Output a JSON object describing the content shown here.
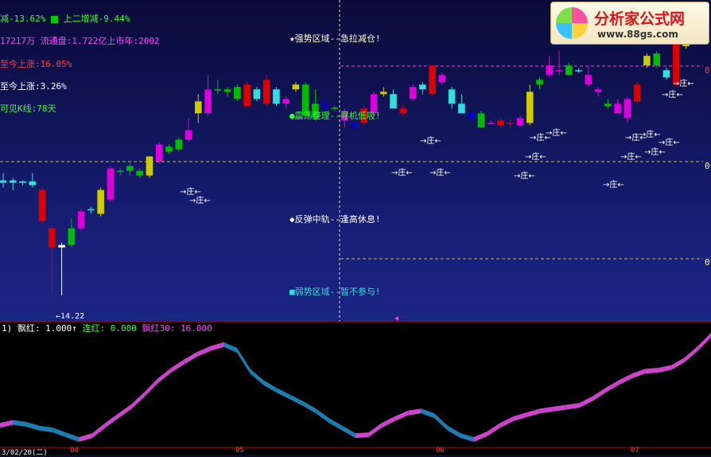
{
  "info_lines": [
    {
      "id": "line1a",
      "text": "减-13.62%",
      "color": "#33ff33"
    },
    {
      "id": "line1b",
      "text": "上二增减-9.44%",
      "color": "#33ff33",
      "marker": "green-square"
    },
    {
      "id": "line2",
      "text": "17217万  流通盘:1.722亿上市年:2002",
      "color": "#ff44ff"
    },
    {
      "id": "line3",
      "text": "至今上涨:16.05%",
      "color": "#ff4040"
    },
    {
      "id": "line4",
      "text": "至今上涨:3.26%",
      "color": "#ffffff"
    },
    {
      "id": "line5",
      "text": "可见K线:78天",
      "color": "#33ff33"
    }
  ],
  "zones": [
    {
      "id": "strong",
      "text": "★强势区域--急拉减仓!",
      "color": "#ffffcc"
    },
    {
      "id": "shake",
      "text": "●震荡整理--寻机低吸!",
      "color": "#33ff33"
    },
    {
      "id": "rebound",
      "text": "◆反弹中轨--逢高休息!",
      "color": "#ffffff"
    },
    {
      "id": "weak",
      "text": "■弱势区域--暂不参与!",
      "color": "#33dddd"
    }
  ],
  "right_axis_labels": [
    "0",
    "0",
    "0"
  ],
  "low_label": "←14.22",
  "indicator_header": {
    "index": "1)",
    "label1": "飘红: 1.000↑",
    "label2": "连红: 0.000",
    "label3": "飘红30: 16.000"
  },
  "bottom_axis": {
    "date": "3/02/20(二)",
    "months": [
      "04",
      "05",
      "06",
      "07"
    ]
  },
  "zhuang_mark": "→庄←",
  "logo": {
    "title": "分析家公式网",
    "url": "www.88gs.com"
  },
  "chart_data": {
    "type": "candlestick",
    "y_range": [
      13.8,
      20.2
    ],
    "candles": [
      {
        "o": 16.55,
        "h": 16.75,
        "l": 16.45,
        "c": 16.6,
        "col": "#33dddd"
      },
      {
        "o": 16.6,
        "h": 16.65,
        "l": 16.4,
        "c": 16.55,
        "col": "#33dddd"
      },
      {
        "o": 16.55,
        "h": 16.6,
        "l": 16.5,
        "c": 16.58,
        "col": "#33dddd"
      },
      {
        "o": 16.58,
        "h": 16.75,
        "l": 16.45,
        "c": 16.5,
        "col": "#33dddd"
      },
      {
        "o": 16.4,
        "h": 16.45,
        "l": 15.7,
        "c": 15.75,
        "col": "#dd0000"
      },
      {
        "o": 15.6,
        "h": 15.65,
        "l": 14.25,
        "c": 15.2,
        "col": "#dd0000"
      },
      {
        "o": 15.2,
        "h": 15.3,
        "l": 14.2,
        "c": 15.25,
        "col": "#ffffff"
      },
      {
        "o": 15.25,
        "h": 15.8,
        "l": 15.2,
        "c": 15.6,
        "col": "#00bb00"
      },
      {
        "o": 15.6,
        "h": 16.0,
        "l": 15.55,
        "c": 15.95,
        "col": "#dd00dd"
      },
      {
        "o": 16.0,
        "h": 16.05,
        "l": 15.9,
        "c": 16.0,
        "col": "#33dddd"
      },
      {
        "o": 15.9,
        "h": 16.45,
        "l": 15.85,
        "c": 16.4,
        "col": "#cccc00"
      },
      {
        "o": 16.2,
        "h": 16.9,
        "l": 16.15,
        "c": 16.85,
        "col": "#dd00dd"
      },
      {
        "o": 16.8,
        "h": 16.85,
        "l": 16.7,
        "c": 16.78,
        "col": "#00bb00"
      },
      {
        "o": 16.8,
        "h": 16.95,
        "l": 16.7,
        "c": 16.9,
        "col": "#00bb00"
      },
      {
        "o": 16.7,
        "h": 16.85,
        "l": 16.65,
        "c": 16.8,
        "col": "#00bb00"
      },
      {
        "o": 16.7,
        "h": 17.1,
        "l": 16.65,
        "c": 17.1,
        "col": "#cccc00"
      },
      {
        "o": 17.0,
        "h": 17.4,
        "l": 16.95,
        "c": 17.35,
        "col": "#dd00dd"
      },
      {
        "o": 17.2,
        "h": 17.35,
        "l": 17.15,
        "c": 17.3,
        "col": "#00bb00"
      },
      {
        "o": 17.25,
        "h": 17.5,
        "l": 17.2,
        "c": 17.45,
        "col": "#00bb00"
      },
      {
        "o": 17.45,
        "h": 17.9,
        "l": 17.4,
        "c": 17.65,
        "col": "#dd00dd"
      },
      {
        "o": 18.0,
        "h": 18.4,
        "l": 17.8,
        "c": 18.25,
        "col": "#cccc00"
      },
      {
        "o": 18.0,
        "h": 18.8,
        "l": 17.95,
        "c": 18.5,
        "col": "#dd00dd"
      },
      {
        "o": 18.5,
        "h": 18.7,
        "l": 18.4,
        "c": 18.5,
        "col": "#00bb00"
      },
      {
        "o": 18.5,
        "h": 18.55,
        "l": 18.35,
        "c": 18.45,
        "col": "#00bb00"
      },
      {
        "o": 18.3,
        "h": 18.6,
        "l": 18.25,
        "c": 18.55,
        "col": "#00bb00"
      },
      {
        "o": 18.6,
        "h": 18.65,
        "l": 18.15,
        "c": 18.15,
        "col": "#dd0000"
      },
      {
        "o": 18.3,
        "h": 18.55,
        "l": 18.25,
        "c": 18.5,
        "col": "#33dddd"
      },
      {
        "o": 18.2,
        "h": 18.8,
        "l": 18.15,
        "c": 18.7,
        "col": "#dd0000"
      },
      {
        "o": 18.5,
        "h": 18.55,
        "l": 18.15,
        "c": 18.2,
        "col": "#33dddd"
      },
      {
        "o": 18.3,
        "h": 18.35,
        "l": 18.1,
        "c": 18.2,
        "col": "#dd00dd"
      },
      {
        "o": 18.5,
        "h": 18.65,
        "l": 18.45,
        "c": 18.6,
        "col": "#cccc00"
      },
      {
        "o": 18.6,
        "h": 18.65,
        "l": 17.9,
        "c": 17.95,
        "col": "#00bb00"
      },
      {
        "o": 18.2,
        "h": 18.5,
        "l": 17.85,
        "c": 17.9,
        "col": "#00bb00"
      },
      {
        "o": 18.2,
        "h": 18.3,
        "l": 18.05,
        "c": 18.15,
        "col": "#0000cc"
      },
      {
        "o": 18.1,
        "h": 18.15,
        "l": 18.05,
        "c": 18.12,
        "col": "#00bb00"
      },
      {
        "o": 18.05,
        "h": 18.1,
        "l": 17.7,
        "c": 17.85,
        "col": "#dd00dd"
      },
      {
        "o": 17.8,
        "h": 17.85,
        "l": 17.6,
        "c": 17.7,
        "col": "#0000cc"
      },
      {
        "o": 18.1,
        "h": 18.15,
        "l": 17.75,
        "c": 17.8,
        "col": "#dd0000"
      },
      {
        "o": 18.0,
        "h": 18.45,
        "l": 17.95,
        "c": 18.4,
        "col": "#dd00dd"
      },
      {
        "o": 18.4,
        "h": 18.55,
        "l": 18.35,
        "c": 18.45,
        "col": "#cccc00"
      },
      {
        "o": 18.4,
        "h": 18.5,
        "l": 18.1,
        "c": 18.1,
        "col": "#33dddd"
      },
      {
        "o": 18.1,
        "h": 18.2,
        "l": 17.95,
        "c": 18.0,
        "col": "#dd0000"
      },
      {
        "o": 18.3,
        "h": 18.6,
        "l": 18.25,
        "c": 18.55,
        "col": "#dd00dd"
      },
      {
        "o": 18.5,
        "h": 18.65,
        "l": 18.4,
        "c": 18.6,
        "col": "#33dddd"
      },
      {
        "o": 18.4,
        "h": 19.0,
        "l": 18.35,
        "c": 19.0,
        "col": "#dd0000"
      },
      {
        "o": 18.8,
        "h": 18.85,
        "l": 18.6,
        "c": 18.65,
        "col": "#dd00dd"
      },
      {
        "o": 18.5,
        "h": 18.55,
        "l": 18.1,
        "c": 18.2,
        "col": "#33dddd"
      },
      {
        "o": 18.2,
        "h": 18.4,
        "l": 18.0,
        "c": 18.0,
        "col": "#33dddd"
      },
      {
        "o": 18.0,
        "h": 18.05,
        "l": 17.85,
        "c": 17.9,
        "col": "#0000cc"
      },
      {
        "o": 18.0,
        "h": 18.05,
        "l": 17.7,
        "c": 17.7,
        "col": "#00bb00"
      },
      {
        "o": 17.8,
        "h": 17.85,
        "l": 17.75,
        "c": 17.8,
        "col": "#dd00dd"
      },
      {
        "o": 17.85,
        "h": 17.9,
        "l": 17.7,
        "c": 17.75,
        "col": "#dd0000"
      },
      {
        "o": 17.8,
        "h": 17.85,
        "l": 17.7,
        "c": 17.78,
        "col": "#dd0000"
      },
      {
        "o": 17.9,
        "h": 17.95,
        "l": 17.7,
        "c": 17.75,
        "col": "#dd00dd"
      },
      {
        "o": 17.8,
        "h": 18.6,
        "l": 17.75,
        "c": 18.45,
        "col": "#cccc00"
      },
      {
        "o": 18.6,
        "h": 18.75,
        "l": 18.5,
        "c": 18.7,
        "col": "#00bb00"
      },
      {
        "o": 18.8,
        "h": 19.2,
        "l": 18.75,
        "c": 19.0,
        "col": "#dd00dd"
      },
      {
        "o": 18.9,
        "h": 19.3,
        "l": 18.8,
        "c": 18.9,
        "col": "#dd00dd"
      },
      {
        "o": 19.0,
        "h": 19.05,
        "l": 18.8,
        "c": 18.8,
        "col": "#00bb00"
      },
      {
        "o": 18.9,
        "h": 18.95,
        "l": 18.85,
        "c": 18.9,
        "col": "#33dddd"
      },
      {
        "o": 18.8,
        "h": 19.0,
        "l": 18.55,
        "c": 18.6,
        "col": "#dd00dd"
      },
      {
        "o": 18.5,
        "h": 18.55,
        "l": 18.35,
        "c": 18.45,
        "col": "#dd00dd"
      },
      {
        "o": 18.2,
        "h": 18.3,
        "l": 18.1,
        "c": 18.15,
        "col": "#00bb00"
      },
      {
        "o": 18.2,
        "h": 18.3,
        "l": 18.1,
        "c": 18.0,
        "col": "#dd00dd"
      },
      {
        "o": 18.3,
        "h": 18.35,
        "l": 17.8,
        "c": 17.9,
        "col": "#dd00dd"
      },
      {
        "o": 18.6,
        "h": 18.65,
        "l": 18.2,
        "c": 18.25,
        "col": "#dd0000"
      },
      {
        "o": 19.0,
        "h": 19.25,
        "l": 18.95,
        "c": 19.2,
        "col": "#cccc00"
      },
      {
        "o": 19.0,
        "h": 19.3,
        "l": 18.95,
        "c": 19.25,
        "col": "#00bb00"
      },
      {
        "o": 18.9,
        "h": 18.95,
        "l": 18.7,
        "c": 18.75,
        "col": "#33dddd"
      },
      {
        "o": 18.6,
        "h": 19.7,
        "l": 18.55,
        "c": 19.65,
        "col": "#dd0000"
      },
      {
        "o": 19.4,
        "h": 20.1,
        "l": 19.35,
        "c": 19.95,
        "col": "#cccc00"
      },
      {
        "o": 19.9,
        "h": 20.1,
        "l": 19.8,
        "c": 19.95,
        "col": "#33dddd"
      },
      {
        "o": 19.95,
        "h": 20.15,
        "l": 19.9,
        "c": 20.0,
        "col": "#0000cc"
      }
    ],
    "indicator": {
      "series": [
        {
          "name": "飘红",
          "values": [
            0.05,
            0.08,
            0.06,
            0.02,
            0.0,
            -0.05,
            -0.1,
            -0.06,
            0.05,
            0.15,
            0.25,
            0.38,
            0.52,
            0.63,
            0.72,
            0.8,
            0.86,
            0.9,
            0.84,
            0.62,
            0.5,
            0.42,
            0.35,
            0.28,
            0.2,
            0.1,
            0.02,
            -0.06,
            -0.05,
            0.05,
            0.12,
            0.18,
            0.2,
            0.15,
            0.02,
            -0.06,
            -0.1,
            -0.04,
            0.05,
            0.12,
            0.16,
            0.2,
            0.22,
            0.24,
            0.26,
            0.33,
            0.42,
            0.5,
            0.57,
            0.62,
            0.63,
            0.66,
            0.74,
            0.86,
            1.0
          ]
        }
      ]
    }
  }
}
